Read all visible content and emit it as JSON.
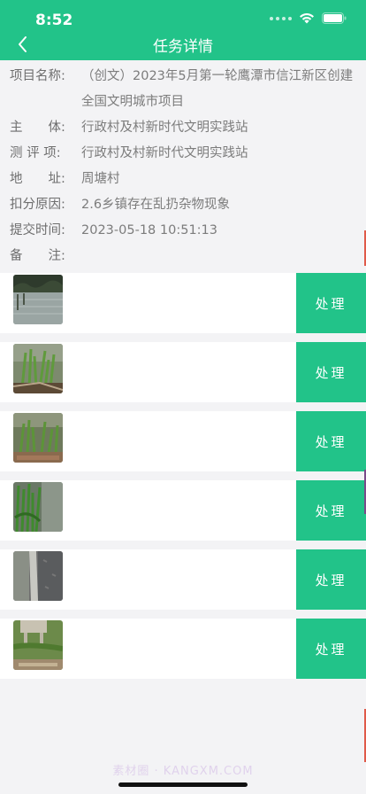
{
  "status_bar": {
    "time": "8:52"
  },
  "nav": {
    "title": "任务详情"
  },
  "details": [
    {
      "label": "项目名称:",
      "value": "（创文）2023年5月第一轮鹰潭市信江新区创建全国文明城市项目"
    },
    {
      "label": "主　　体:",
      "value": "行政村及村新时代文明实践站"
    },
    {
      "label": "测 评 项:",
      "value": "行政村及村新时代文明实践站"
    },
    {
      "label": "地　　址:",
      "value": "周塘村"
    },
    {
      "label": "扣分原因:",
      "value": "2.6乡镇存在乱扔杂物现象"
    },
    {
      "label": "提交时间:",
      "value": "2023-05-18 10:51:13"
    },
    {
      "label": "备　　注:",
      "value": ""
    }
  ],
  "items": [
    {
      "photo": "pond-water-photo",
      "action": "处理"
    },
    {
      "photo": "grass-shore-photo",
      "action": "处理"
    },
    {
      "photo": "grass-shore-photo-2",
      "action": "处理"
    },
    {
      "photo": "plants-by-wall-photo",
      "action": "处理"
    },
    {
      "photo": "road-curb-photo",
      "action": "处理"
    },
    {
      "photo": "yard-debris-photo",
      "action": "处理"
    }
  ],
  "watermark": "素材圈 · KANGXM.COM",
  "colors": {
    "accent": "#22c389",
    "background": "#f3f3f5"
  }
}
